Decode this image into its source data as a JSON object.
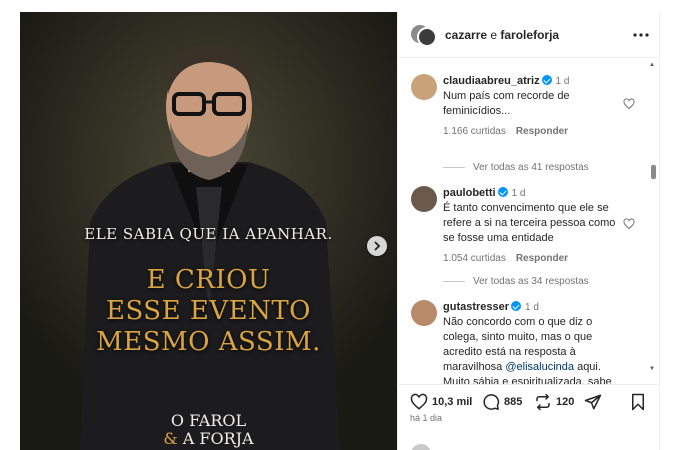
{
  "post": {
    "image": {
      "caption_top": "ELE SABIA QUE IA APANHAR.",
      "caption_big": [
        "E CRIOU",
        "ESSE EVENTO",
        "MESMO ASSIM."
      ],
      "brand_line1": "O FAROL",
      "brand_amp": "&",
      "brand_line2": " A FORJA"
    }
  },
  "header": {
    "user1": "cazarre",
    "conj": " e ",
    "user2": "faroleforja"
  },
  "comments": [
    {
      "user": "claudiaabreu_atriz",
      "time": "1 d",
      "text": "Num país com recorde de feminicídios...",
      "likes": "1.166 curtidas",
      "reply": "Responder",
      "replies": "Ver todas as 41 respostas",
      "avatar_color": "#c9a27a"
    },
    {
      "user": "paulobetti",
      "time": "1 d",
      "text": "É tanto convencimento que ele se refere a si na terceira pessoa como se fosse uma entidade",
      "likes": "1.054 curtidas",
      "reply": "Responder",
      "replies": "Ver todas as 34 respostas",
      "avatar_color": "#6b5a4c"
    },
    {
      "user": "gutastresser",
      "time": "1 d",
      "text_before": "Não concordo com o que diz o colega, sinto muito, mas o que acredito está na resposta à maravilhosa ",
      "mention": "@elisalucinda",
      "text_after": " aqui. Muito sábia e espiritualizada, sabe",
      "avatar_color": "#b98a6a"
    }
  ],
  "actions": {
    "likes": "10,3 mil",
    "comments": "885",
    "reposts": "120"
  },
  "timestamp": "há 1 dia",
  "colors": {
    "accent_gold": "#d9a441",
    "verified": "#0095f6",
    "muted": "#737373"
  }
}
